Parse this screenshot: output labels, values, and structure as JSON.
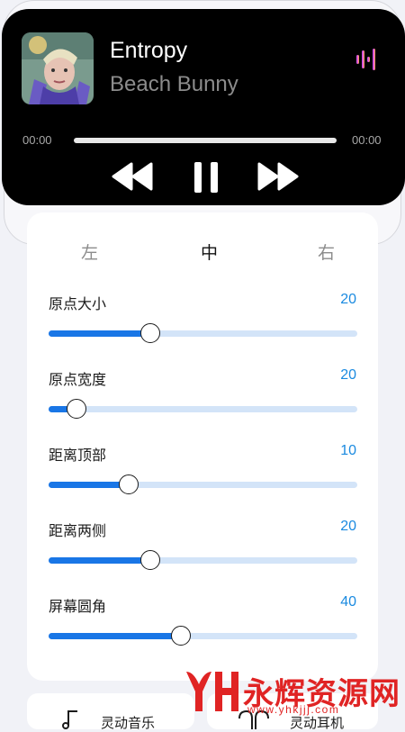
{
  "player": {
    "title": "Entropy",
    "artist": "Beach Bunny",
    "elapsed": "00:00",
    "total": "00:00",
    "progress": 0
  },
  "tabs": [
    {
      "label": "左",
      "active": false
    },
    {
      "label": "中",
      "active": true
    },
    {
      "label": "右",
      "active": false
    }
  ],
  "sliders": [
    {
      "label": "原点大小",
      "value": "20",
      "level": 0.33
    },
    {
      "label": "原点宽度",
      "value": "20",
      "level": 0.09
    },
    {
      "label": "距离顶部",
      "value": "10",
      "level": 0.26
    },
    {
      "label": "距离两侧",
      "value": "20",
      "level": 0.33
    },
    {
      "label": "屏幕圆角",
      "value": "40",
      "level": 0.43
    }
  ],
  "bottom": {
    "music_label": "灵动音乐",
    "earphone_label": "灵动耳机"
  },
  "watermark": {
    "text": "永辉资源网",
    "url": "www.yhkjjj.com"
  },
  "colors": {
    "accent": "#1976e6",
    "track": "#d3e4f8",
    "value_text": "#1a8ae0"
  }
}
